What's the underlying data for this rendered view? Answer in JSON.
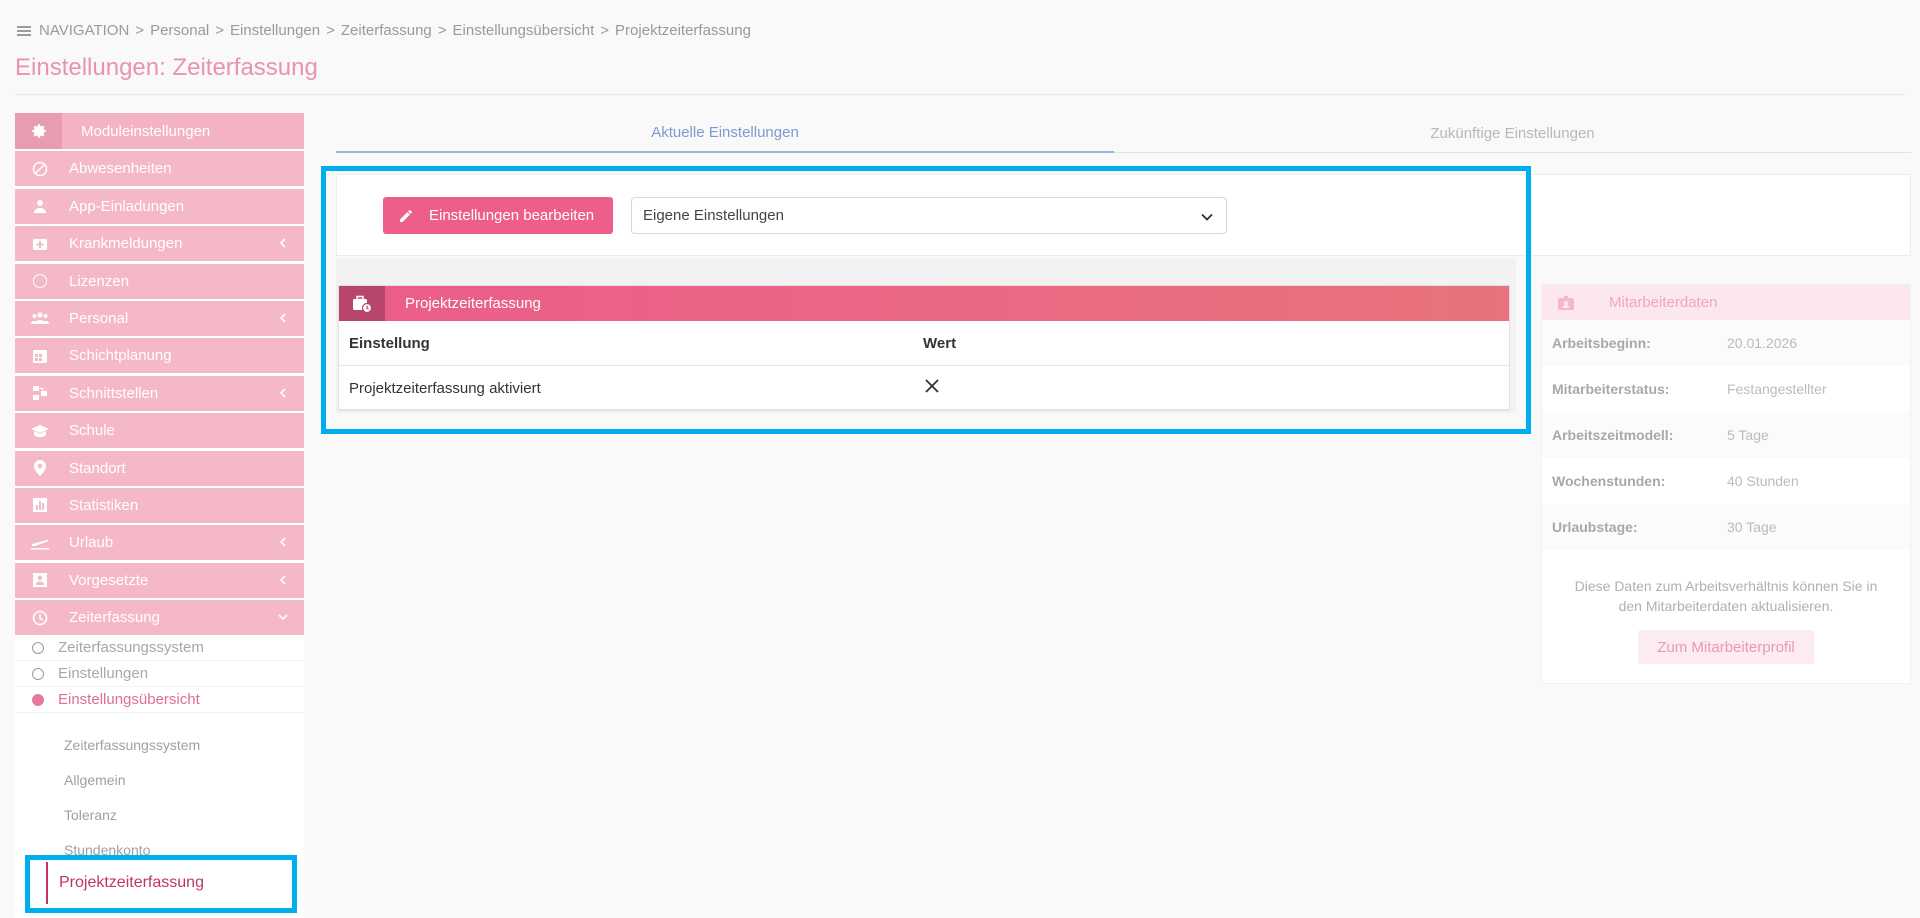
{
  "breadcrumb": [
    "NAVIGATION",
    "Personal",
    "Einstellungen",
    "Zeiterfassung",
    "Einstellungsübersicht",
    "Projektzeiterfassung"
  ],
  "page_title": "Einstellungen: Zeiterfassung",
  "sidebar": {
    "header": "Moduleinstellungen",
    "items": [
      {
        "label": "Abwesenheiten",
        "icon": "ban-icon"
      },
      {
        "label": "App-Einladungen",
        "icon": "user-icon"
      },
      {
        "label": "Krankmeldungen",
        "icon": "medical-icon",
        "expandable": true
      },
      {
        "label": "Lizenzen",
        "icon": "circle-icon"
      },
      {
        "label": "Personal",
        "icon": "group-icon",
        "expandable": true
      },
      {
        "label": "Schichtplanung",
        "icon": "calendar-icon"
      },
      {
        "label": "Schnittstellen",
        "icon": "interface-icon",
        "expandable": true
      },
      {
        "label": "Schule",
        "icon": "school-icon"
      },
      {
        "label": "Standort",
        "icon": "pin-icon"
      },
      {
        "label": "Statistiken",
        "icon": "chart-icon"
      },
      {
        "label": "Urlaub",
        "icon": "plane-icon",
        "expandable": true
      },
      {
        "label": "Vorgesetzte",
        "icon": "supervisor-icon",
        "expandable": true
      },
      {
        "label": "Zeiterfassung",
        "icon": "clock-icon",
        "expanded": true
      }
    ],
    "sub_items": [
      {
        "label": "Zeiterfassungssystem",
        "active": false
      },
      {
        "label": "Einstellungen",
        "active": false
      },
      {
        "label": "Einstellungsübersicht",
        "active": true
      }
    ],
    "subsub_items": [
      "Zeiterfassungssystem",
      "Allgemein",
      "Toleranz",
      "Stundenkonto"
    ],
    "active_subsub": "Projektzeiterfassung"
  },
  "tabs": [
    "Aktuelle Einstellungen",
    "Zukünftige Einstellungen"
  ],
  "toolbar": {
    "edit_label": "Einstellungen bearbeiten",
    "select_value": "Eigene Einstellungen"
  },
  "panel": {
    "title": "Projektzeiterfassung",
    "columns": [
      "Einstellung",
      "Wert"
    ],
    "rows": [
      {
        "setting": "Projektzeiterfassung aktiviert",
        "value": "✕"
      }
    ]
  },
  "employee": {
    "title": "Mitarbeiterdaten",
    "rows": [
      {
        "k": "Arbeitsbeginn:",
        "v": "20.01.2026"
      },
      {
        "k": "Mitarbeiterstatus:",
        "v": "Festangestellter"
      },
      {
        "k": "Arbeitszeitmodell:",
        "v": "5 Tage"
      },
      {
        "k": "Wochenstunden:",
        "v": "40 Stunden"
      },
      {
        "k": "Urlaubstage:",
        "v": "30 Tage"
      }
    ],
    "note": "Diese Daten zum Arbeitsverhältnis können Sie in den Mitarbeiterdaten aktualisieren.",
    "button": "Zum Mitarbeiterprofil"
  }
}
